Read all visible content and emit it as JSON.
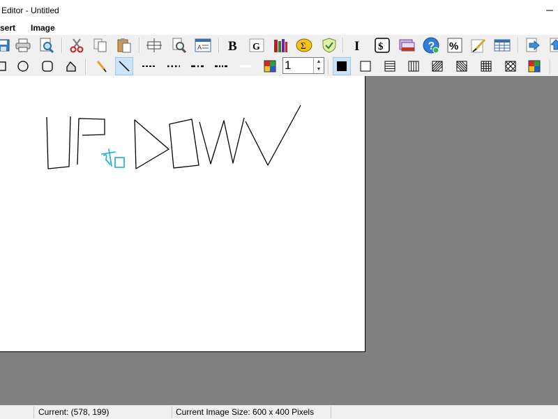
{
  "window": {
    "title": "Editor - Untitled"
  },
  "menu": {
    "insert": "sert",
    "image": "Image"
  },
  "line_width": {
    "value": "1"
  },
  "status": {
    "current": "Current: (578, 199)",
    "image_size": "Current Image Size: 600 x 400 Pixels"
  },
  "colors": {
    "canvas": "#ffffff",
    "workspace": "#808080",
    "drawing_black": "#000000",
    "drawing_cyan": "#29b6d6",
    "active_tool": "#cce4f7"
  },
  "toolbar_icons": [
    "save-icon",
    "print-icon",
    "print-preview-icon",
    "cut-icon",
    "copy-icon",
    "paste-icon",
    "resize-icon",
    "zoom-icon",
    "text-frame-icon",
    "bold-icon",
    "font-g-icon",
    "books-icon",
    "sum-icon",
    "shield-check-icon",
    "italic-icon",
    "dollar-icon",
    "folder-stack-icon",
    "help-icon",
    "percent-icon",
    "pen-note-icon",
    "table-icon",
    "arrow-right-icon",
    "arrow-up-icon"
  ],
  "drawing_tools": [
    "rectangle-icon",
    "ellipse-icon",
    "rounded-rect-icon",
    "polygon-icon",
    "pencil-icon",
    "line-icon",
    "dash-line-icon",
    "dot-line-icon",
    "dash-dot-line-icon",
    "dash-dot-dot-line-icon",
    "white-line-icon",
    "color-palette-icon",
    "fill-solid-icon",
    "fill-none-icon",
    "fill-horizontal-icon",
    "fill-vertical-icon",
    "fill-diagonal-icon",
    "fill-back-diagonal-icon",
    "fill-cross-icon",
    "fill-diag-cross-icon",
    "color-palette-2-icon"
  ]
}
